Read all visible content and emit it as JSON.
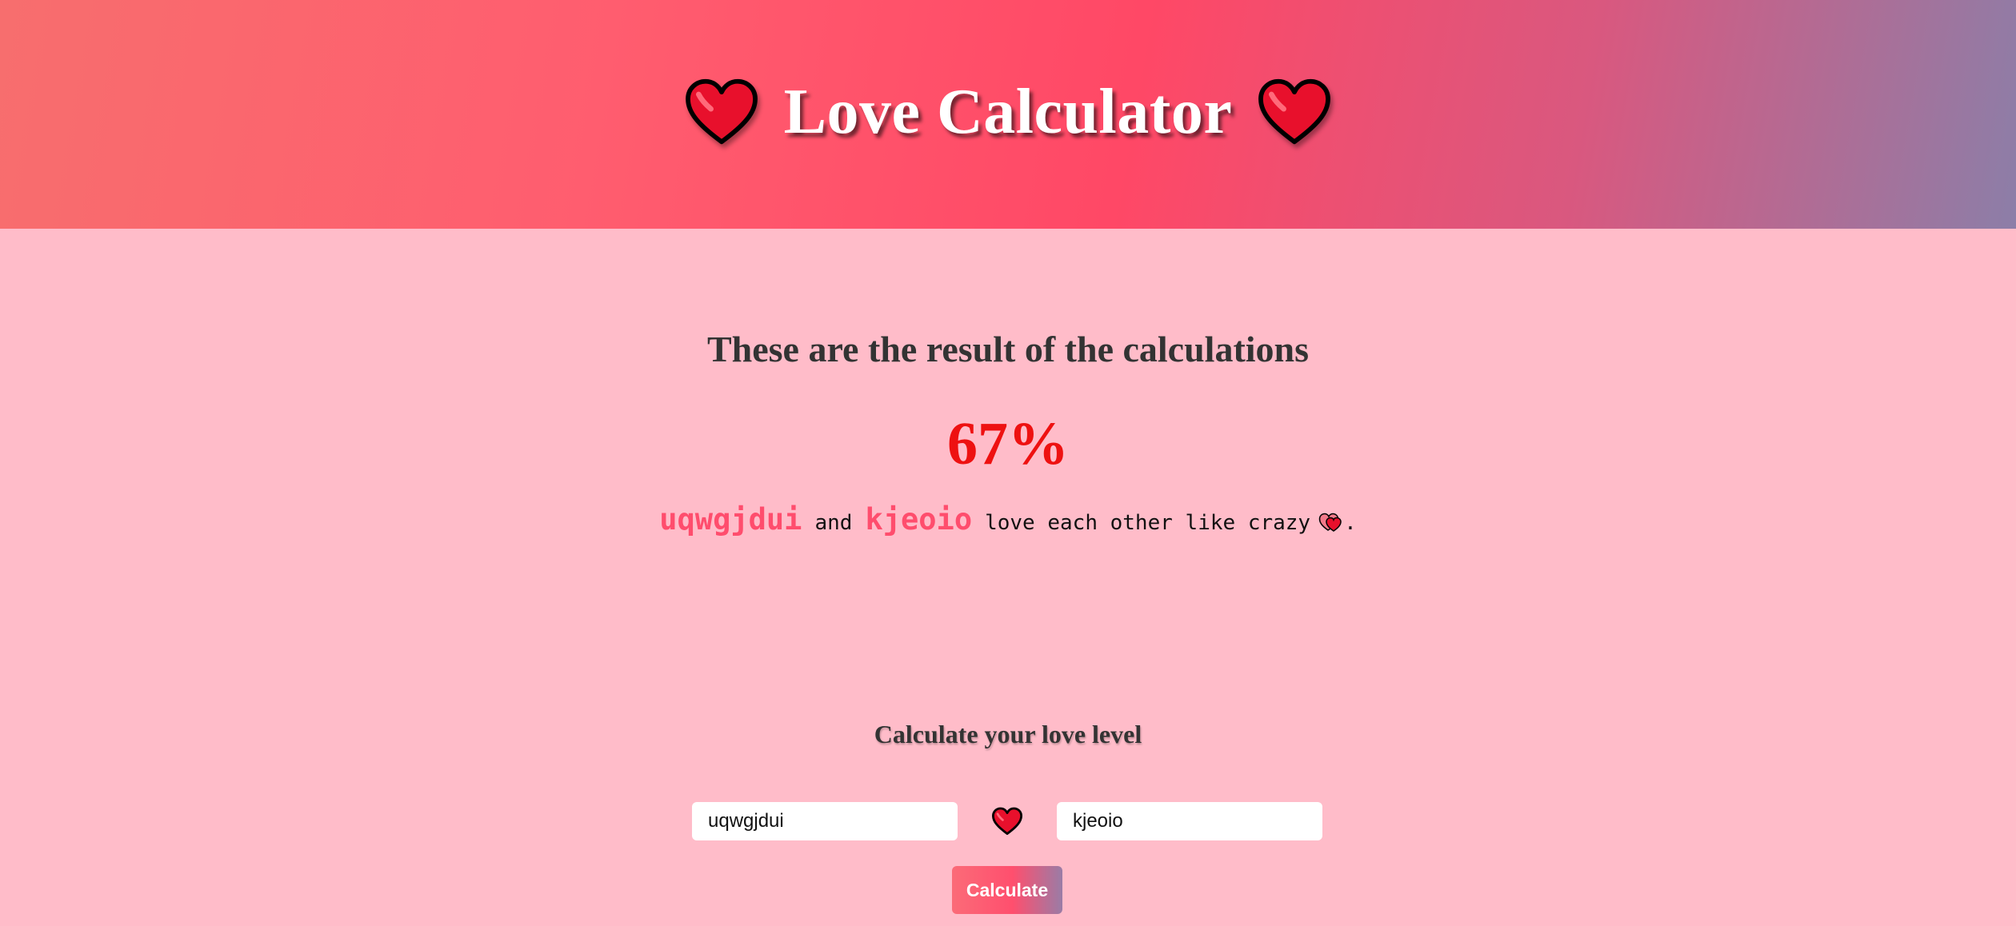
{
  "header": {
    "title": "Love Calculator",
    "left_icon": "heart-icon",
    "right_icon": "heart-icon"
  },
  "result": {
    "heading": "These are the result of the calculations",
    "percent": "67%",
    "name_a": "uqwgjdui",
    "connector": "and",
    "name_b": "kjeoio",
    "message": "love each other like crazy",
    "message_icon": "two-hearts-icon",
    "period": "."
  },
  "form": {
    "heading": "Calculate your love level",
    "name1_value": "uqwgjdui",
    "name2_value": "kjeoio",
    "separator_icon": "heart-icon",
    "button_label": "Calculate"
  },
  "colors": {
    "background": "#ffbcc9",
    "accent_pink": "#ff4d6d",
    "percent_red": "#ee1111",
    "header_gradient": [
      "#f76e6e",
      "#ff4866",
      "#8c7ea8"
    ]
  }
}
